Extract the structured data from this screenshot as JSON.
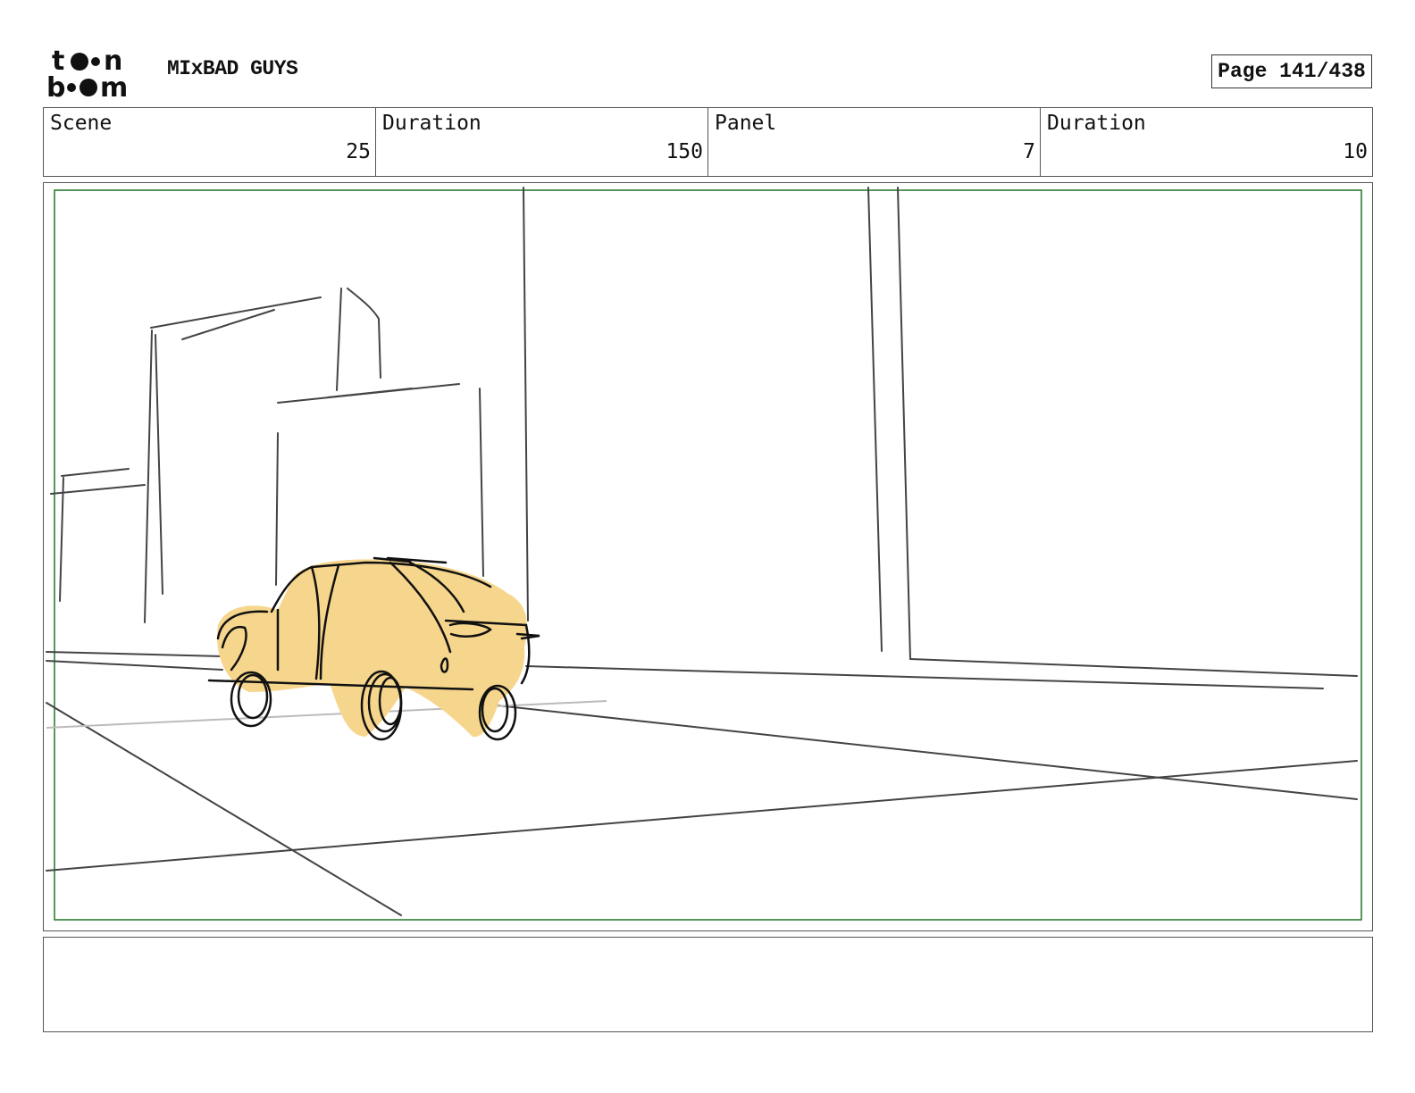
{
  "header": {
    "logo_text": "toon boom",
    "project_title": "MIxBAD GUYS",
    "page_label": "Page 141/438"
  },
  "info": {
    "scene_label": "Scene",
    "scene_value": "25",
    "scene_duration_label": "Duration",
    "scene_duration_value": "150",
    "panel_label": "Panel",
    "panel_value": "7",
    "panel_duration_label": "Duration",
    "panel_duration_value": "10"
  },
  "notes": {
    "text": ""
  },
  "colors": {
    "safe_frame": "#2e7d32",
    "car_fill": "#f6d68c",
    "line": "#222222"
  }
}
